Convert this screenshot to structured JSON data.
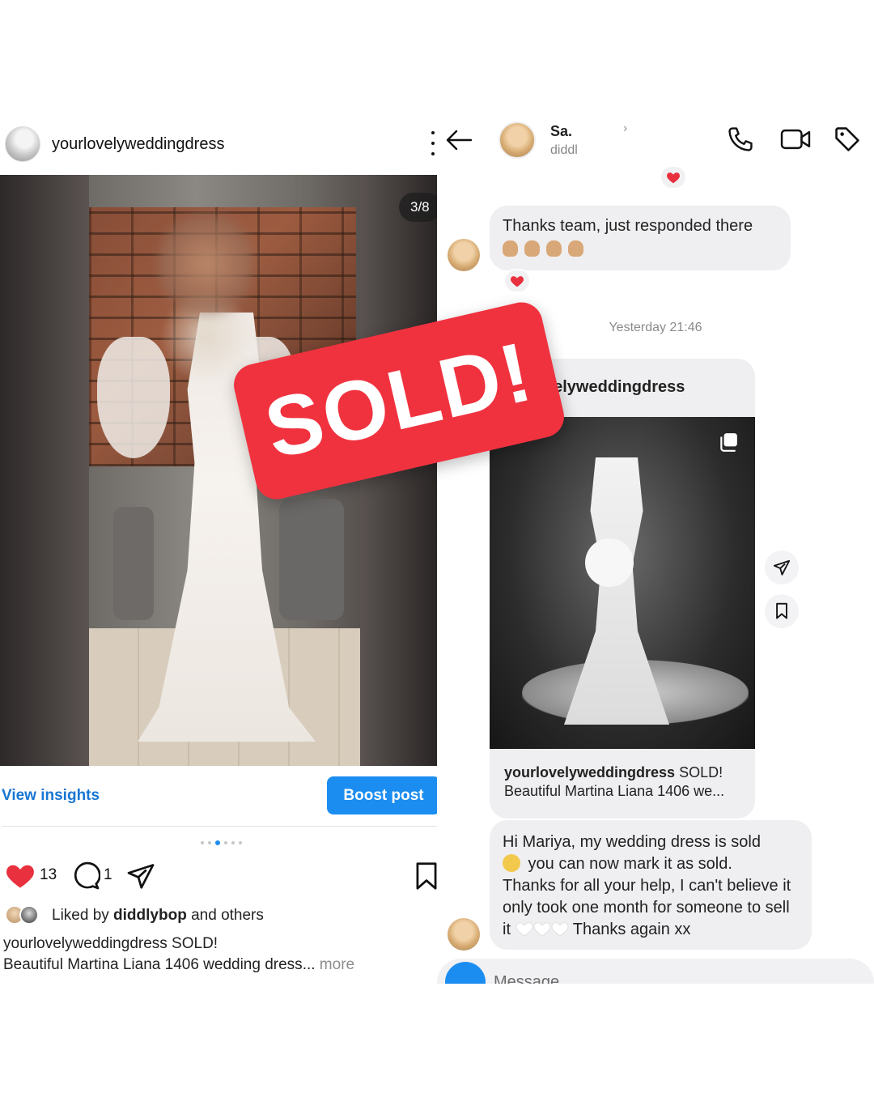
{
  "post": {
    "username": "yourlovelyweddingdress",
    "carousel_counter": "3/8",
    "view_insights": "View insights",
    "boost_post": "Boost post",
    "likes": "13",
    "comments": "1",
    "liked_by_prefix": "Liked by ",
    "liked_by_user": "diddlybop",
    "liked_by_suffix": " and others",
    "caption_user": "yourlovelyweddingdress",
    "caption_line1": " SOLD!",
    "caption_line2": "Beautiful Martina Liana 1406 wedding dress",
    "caption_ellipsis": "...",
    "caption_more": " more",
    "carousel_dots": 6,
    "carousel_active": 3
  },
  "dm": {
    "contact_name": "Sa.",
    "contact_handle": "diddl",
    "chevron": "›",
    "message1": "Thanks team, just responded there",
    "timestamp": "Yesterday 21:46",
    "shared_username": "ourlovelyweddingdress",
    "shared_caption_user": "yourlovelyweddingdress",
    "shared_caption_text": " SOLD!",
    "shared_caption_line2": "Beautiful Martina Liana 1406 we...",
    "message2_part1": "Hi Mariya, my wedding dress is sold",
    "message2_part2": " you can now mark it as sold.",
    "message2_part3": "Thanks for all your help, I can't believe it only took one month for someone to sell it",
    "message2_part4": " Thanks again xx",
    "composer_placeholder": "Message..."
  },
  "sticker": {
    "text": "SOLD!",
    "color": "#f0323f"
  },
  "colors": {
    "accent": "#1c8df0",
    "heart": "#e8303e"
  },
  "icons": [
    "more-vert-icon",
    "back-arrow-icon",
    "phone-icon",
    "video-icon",
    "tag-icon",
    "heart-icon",
    "comment-icon",
    "share-icon",
    "bookmark-icon",
    "camera-icon",
    "multi-photo-icon"
  ]
}
